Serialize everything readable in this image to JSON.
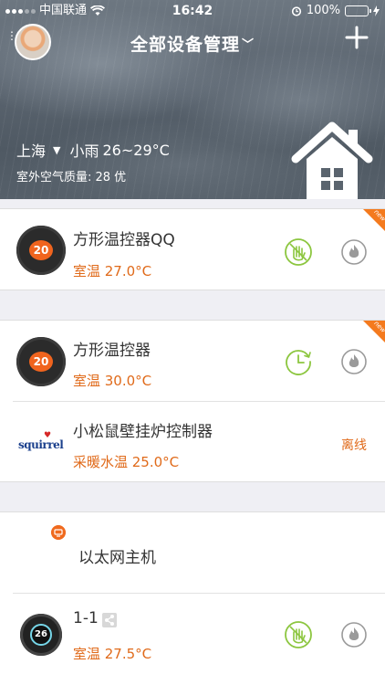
{
  "status_bar": {
    "carrier": "中国联通",
    "time": "16:42",
    "battery": "100%",
    "battery_level": 1.0
  },
  "header": {
    "title": "全部设备管理",
    "weather": {
      "city": "上海",
      "condition": "小雨",
      "temp_range": "26~29°C",
      "air_quality": "室外空气质量: 28 优"
    }
  },
  "groups": [
    {
      "new_badge": "new",
      "devices": [
        {
          "name": "方形温控器QQ",
          "display": "20",
          "temp": "室温 27.0°C",
          "control_icon": "hand-stop-icon"
        }
      ]
    },
    {
      "new_badge": "new",
      "devices": [
        {
          "name": "方形温控器",
          "display": "20",
          "temp": "室温 30.0°C",
          "control_icon": "schedule-clock-icon"
        },
        {
          "name": "小松鼠壁挂炉控制器",
          "logo": "squirrel",
          "temp": "采暖水温 25.0°C",
          "status": "离线"
        }
      ]
    },
    {
      "devices": [
        {
          "name": "以太网主机",
          "icon": "gateway-icon"
        },
        {
          "name": "1-1",
          "display": "26",
          "temp": "室温 27.5°C",
          "control_icon": "hand-stop-icon"
        }
      ]
    }
  ],
  "colors": {
    "accent": "#e06a1a",
    "icon_green": "#8cc63f",
    "icon_gray": "#9a9a9a",
    "badge": "#f47a1e"
  }
}
